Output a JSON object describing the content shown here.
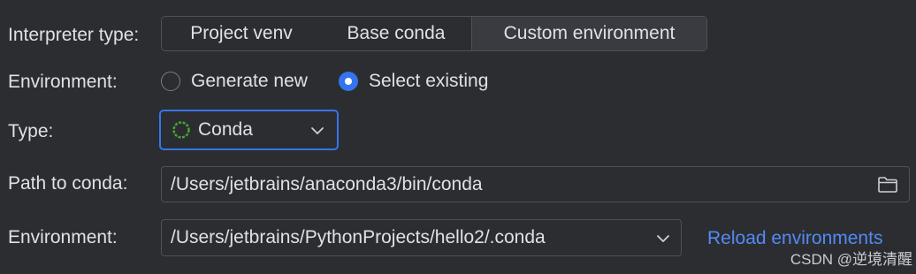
{
  "interpreter": {
    "label": "Interpreter type:",
    "options": [
      "Project venv",
      "Base conda",
      "Custom environment"
    ],
    "selected": "Custom environment"
  },
  "environment_mode": {
    "label": "Environment:",
    "options": [
      {
        "label": "Generate new",
        "checked": false
      },
      {
        "label": "Select existing",
        "checked": true
      }
    ]
  },
  "type": {
    "label": "Type:",
    "value": "Conda",
    "icon": "conda-icon"
  },
  "path": {
    "label": "Path to conda:",
    "value": "/Users/jetbrains/anaconda3/bin/conda",
    "icon": "folder-icon"
  },
  "environment": {
    "label": "Environment:",
    "value": "/Users/jetbrains/PythonProjects/hello2/.conda",
    "reload_link": "Reload environments"
  },
  "watermark": "CSDN @逆境清醒",
  "colors": {
    "background": "#2b2d30",
    "accent": "#3574f0",
    "link": "#548af7",
    "conda_green": "#44a833"
  }
}
